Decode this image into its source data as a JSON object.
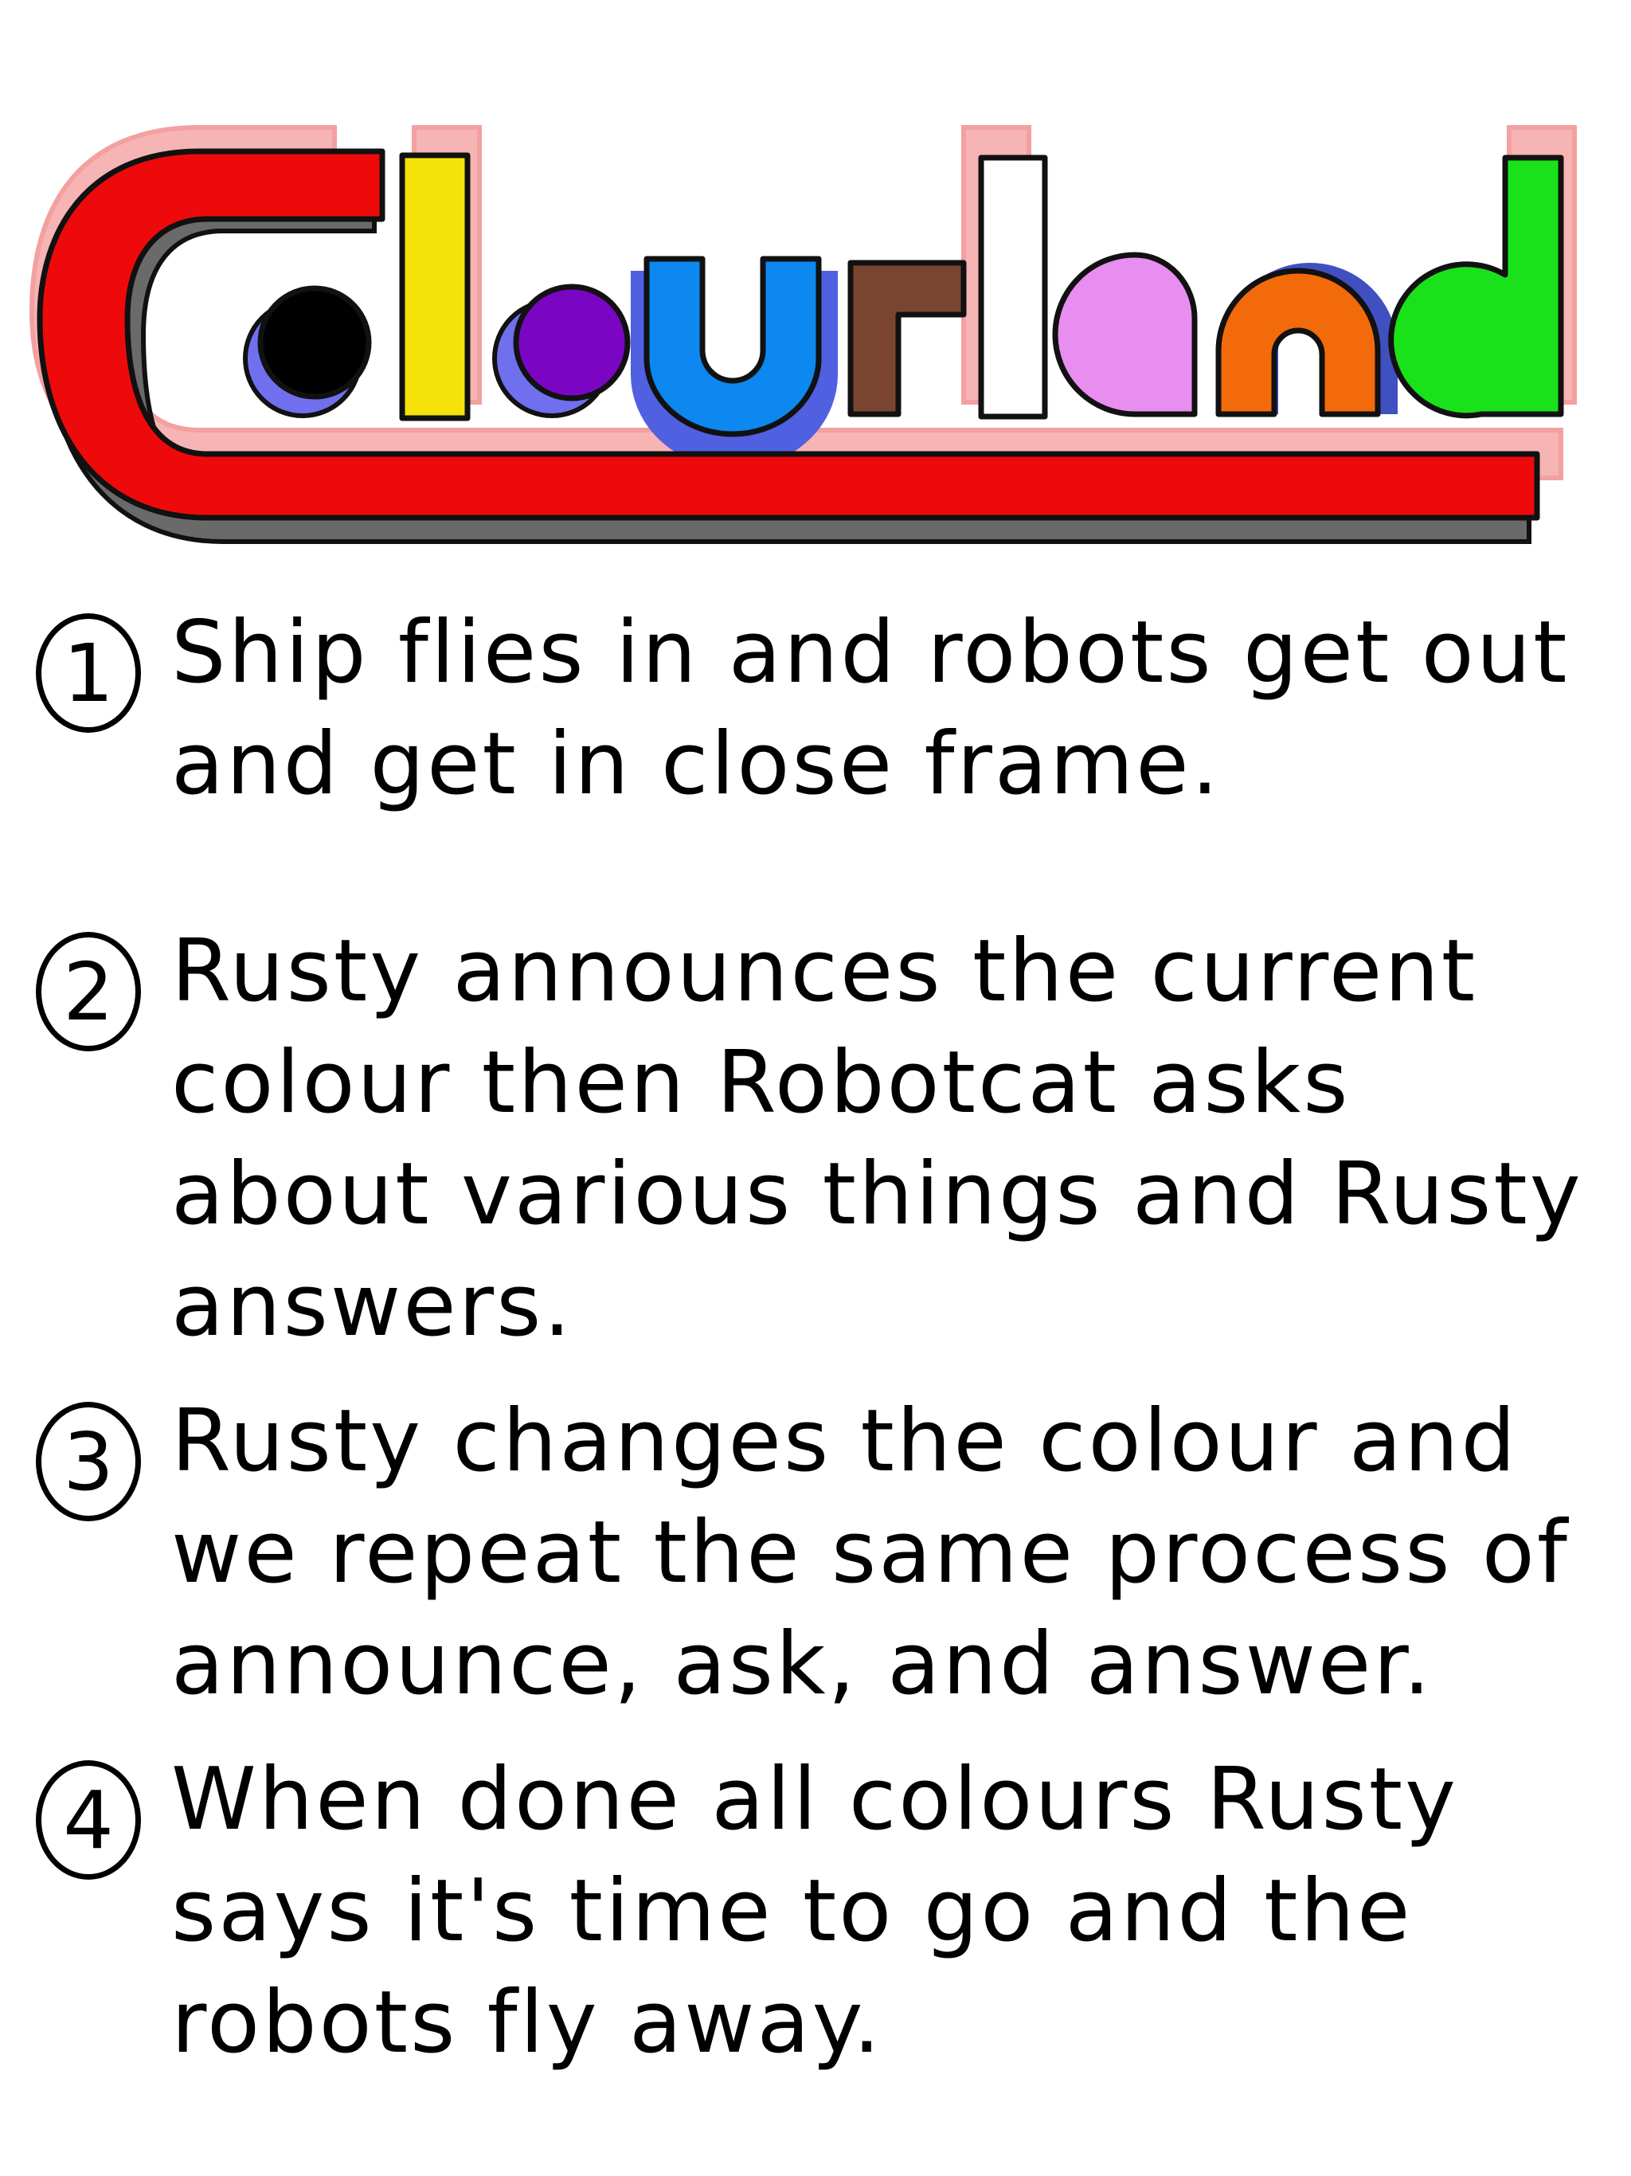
{
  "title": "Colourland",
  "logo_letters": [
    {
      "letter": "C",
      "color": "#ee0a0a"
    },
    {
      "letter": "o",
      "color": "#000000"
    },
    {
      "letter": "l",
      "color": "#f5e20a"
    },
    {
      "letter": "o",
      "color": "#7a06c4"
    },
    {
      "letter": "u",
      "color": "#0c88f0"
    },
    {
      "letter": "r",
      "color": "#7a4530"
    },
    {
      "letter": "l",
      "color": "#ffffff"
    },
    {
      "letter": "a",
      "color": "#e88ef0"
    },
    {
      "letter": "n",
      "color": "#f26a0a"
    },
    {
      "letter": "d",
      "color": "#1ae21a"
    }
  ],
  "steps": [
    {
      "number": "1",
      "text": "Ship flies in and robots get out and get in close frame."
    },
    {
      "number": "2",
      "text": "Rusty announces the current colour then Robotcat asks about various things and Rusty answers."
    },
    {
      "number": "3",
      "text": "Rusty changes the colour and we repeat the same process of announce, ask, and answer."
    },
    {
      "number": "4",
      "text": "When done all colours Rusty says it's time to go and the robots fly away."
    }
  ]
}
